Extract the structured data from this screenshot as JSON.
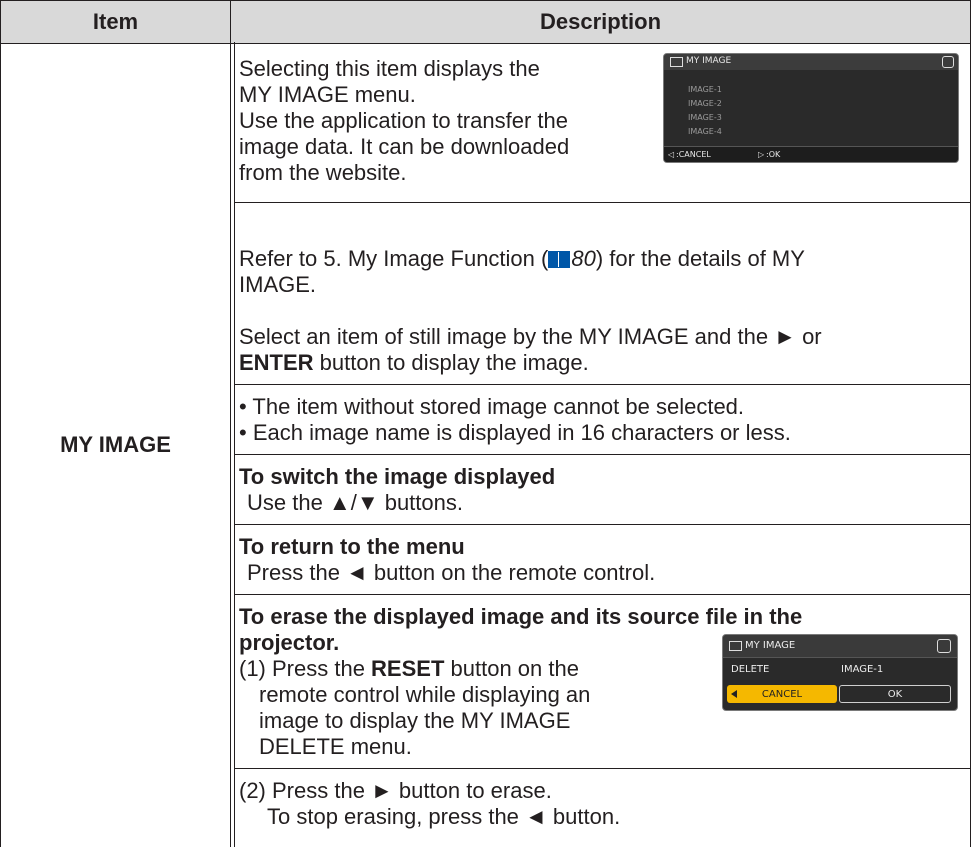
{
  "table": {
    "header": {
      "item": "Item",
      "description": "Description"
    },
    "item_name": "MY IMAGE"
  },
  "desc": {
    "intro_lines": [
      "Selecting this item displays the",
      "MY IMAGE menu.",
      "Use the application to transfer the",
      "image data. It can be downloaded",
      "from the website."
    ],
    "refer_1": "Refer to 5. My Image Function (",
    "refer_page": "80",
    "refer_2": ") for the details of MY",
    "refer_3": "IMAGE.",
    "select_1": "Select an item of still image by the MY IMAGE and the ► or",
    "select_enter": "ENTER",
    "select_2": " button to display the image.",
    "bullet_1": "• The item without stored image cannot be selected.",
    "bullet_2": "• Each image name is displayed in 16 characters or less.",
    "switch_head": "To switch the image displayed",
    "switch_body": "Use the ▲/▼ buttons.",
    "return_head": "To return to the menu",
    "return_body": "Press the ◄ button on the remote control.",
    "erase_head_1": "To erase the displayed image and its source file in the",
    "erase_head_2": "projector.",
    "step1_a": "(1) Press the ",
    "step1_reset": "RESET",
    "step1_b": " button on the",
    "step1_lines": [
      "remote control while displaying an",
      "image to display the MY IMAGE",
      "DELETE menu."
    ],
    "step2_a": "(2) Press the ► button to erase.",
    "step2_b": "To stop erasing, press the ◄ button."
  },
  "screen1": {
    "title": "MY IMAGE",
    "items": [
      "IMAGE-1",
      "IMAGE-2",
      "IMAGE-3",
      "IMAGE-4"
    ],
    "cancel": ":CANCEL",
    "ok": ":OK"
  },
  "screen2": {
    "title": "MY IMAGE",
    "delete_label": "DELETE",
    "image_label": "IMAGE-1",
    "cancel": "CANCEL",
    "ok": "OK",
    "accent": "#f5b800"
  },
  "colors": {
    "header_bg": "#d9d9d9",
    "ref_icon": "#0057a8",
    "text": "#231f20"
  }
}
